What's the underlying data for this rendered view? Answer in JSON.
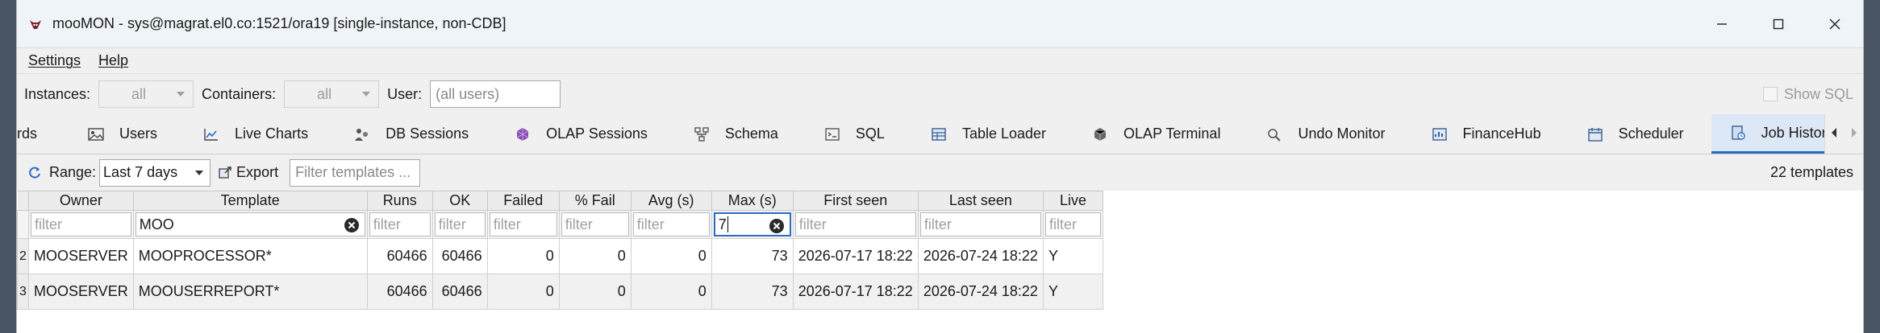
{
  "window": {
    "title": "mooMON - sys@magrat.el0.co:1521/ora19  [single-instance, non-CDB]"
  },
  "menu": {
    "items": [
      "Settings",
      "Help"
    ]
  },
  "filters": {
    "instances_label": "Instances:",
    "instances_value": "all",
    "containers_label": "Containers:",
    "containers_value": "all",
    "user_label": "User:",
    "user_placeholder": "(all users)",
    "show_sql_label": "Show SQL"
  },
  "tabs": [
    {
      "label": "rds",
      "icon": "grid-icon"
    },
    {
      "label": "Users",
      "icon": "image-icon"
    },
    {
      "label": "Live Charts",
      "icon": "line-chart-icon"
    },
    {
      "label": "DB Sessions",
      "icon": "sessions-icon"
    },
    {
      "label": "OLAP Sessions",
      "icon": "cube-icon"
    },
    {
      "label": "Schema",
      "icon": "schema-icon"
    },
    {
      "label": "SQL",
      "icon": "sql-icon"
    },
    {
      "label": "Table Loader",
      "icon": "table-icon"
    },
    {
      "label": "OLAP Terminal",
      "icon": "terminal-icon"
    },
    {
      "label": "Undo Monitor",
      "icon": "undo-icon"
    },
    {
      "label": "FinanceHub",
      "icon": "finance-icon"
    },
    {
      "label": "Scheduler",
      "icon": "calendar-icon"
    },
    {
      "label": "Job History",
      "icon": "history-icon"
    }
  ],
  "toolbar": {
    "range_label": "Range:",
    "range_value": "Last 7 days",
    "export_label": "Export",
    "template_filter_placeholder": "Filter templates ...",
    "count_text": "22 templates"
  },
  "table": {
    "columns": [
      "Owner",
      "Template",
      "Runs",
      "OK",
      "Failed",
      "% Fail",
      "Avg (s)",
      "Max (s)",
      "First seen",
      "Last seen",
      "Live"
    ],
    "filter_placeholder": "filter",
    "filter_template_value": "MOO",
    "filter_max_value": "7",
    "rows": [
      {
        "num": "2",
        "owner": "MOOSERVER",
        "template": "MOOPROCESSOR*",
        "runs": "60466",
        "ok": "60466",
        "failed": "0",
        "pct_fail": "0",
        "avg": "0",
        "max": "73",
        "first_seen": "2026-07-17 18:22",
        "last_seen": "2026-07-24 18:22",
        "live": "Y"
      },
      {
        "num": "3",
        "owner": "MOOSERVER",
        "template": "MOOUSERREPORT*",
        "runs": "60466",
        "ok": "60466",
        "failed": "0",
        "pct_fail": "0",
        "avg": "0",
        "max": "73",
        "first_seen": "2026-07-17 18:22",
        "last_seen": "2026-07-24 18:22",
        "live": "Y"
      }
    ]
  },
  "colors": {
    "accent": "#2b6cc4",
    "active_tab_bg": "#dde8f6",
    "desktop_bg": "#4a5563"
  }
}
